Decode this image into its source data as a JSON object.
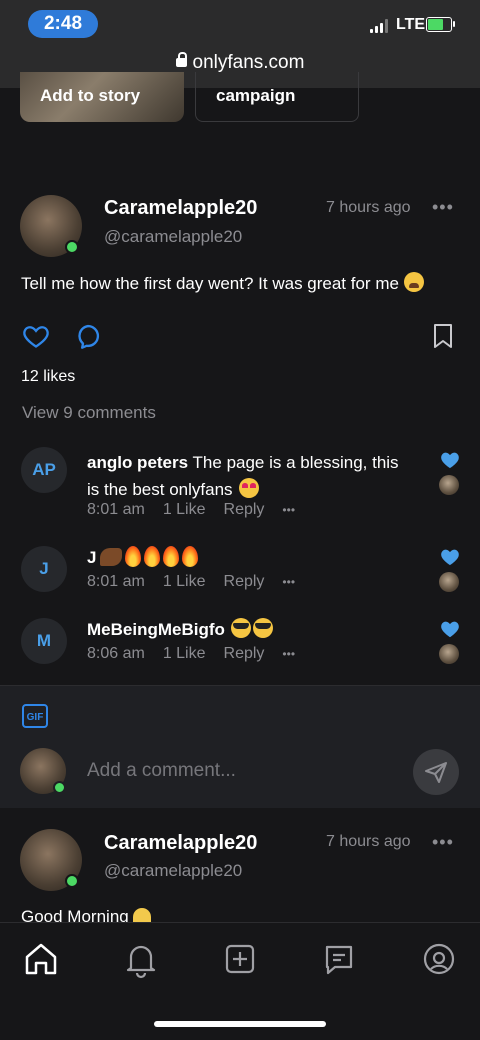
{
  "status": {
    "time": "2:48",
    "network": "LTE",
    "url": "onlyfans.com"
  },
  "top_cards": {
    "story_label": "Add to story",
    "campaign_label": "campaign"
  },
  "post1": {
    "display_name": "Caramelapple20",
    "handle": "@caramelapple20",
    "time_ago": "7 hours ago",
    "more": "•••",
    "text": "Tell me how the first day went? It was great for me",
    "likes_count": "12 likes",
    "view_comments": "View 9 comments"
  },
  "comments": [
    {
      "initials": "AP",
      "name": "anglo peters",
      "text_line1": "The page is a blessing, this",
      "text_line2": "is the best onlyfans",
      "time": "8:01 am",
      "likes": "1 Like",
      "reply": "Reply",
      "more": "•••"
    },
    {
      "initials": "J",
      "name": "J",
      "time": "8:01 am",
      "likes": "1 Like",
      "reply": "Reply",
      "more": "•••"
    },
    {
      "initials": "M",
      "name": "MeBeingMeBigfo",
      "time": "8:06 am",
      "likes": "1 Like",
      "reply": "Reply",
      "more": "•••"
    }
  ],
  "comment_input": {
    "gif_label": "GIF",
    "placeholder": "Add a comment..."
  },
  "post2": {
    "display_name": "Caramelapple20",
    "handle": "@caramelapple20",
    "time_ago": "7 hours ago",
    "more": "•••",
    "text": "Good Morning"
  },
  "tabbar": {
    "icons": [
      "home-icon",
      "bell-icon",
      "add-post-icon",
      "messages-icon",
      "profile-icon"
    ]
  },
  "colors": {
    "accent": "#2f86e8",
    "background": "#161618",
    "online": "#4cd964"
  }
}
